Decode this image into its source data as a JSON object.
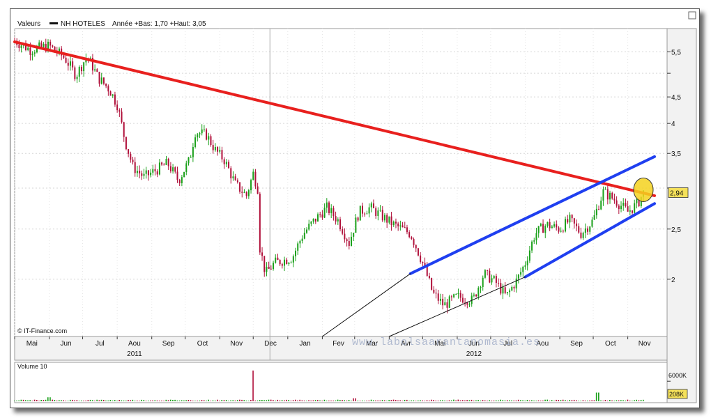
{
  "legend": {
    "label": "Valeurs",
    "series": "NH HOTELES",
    "range_text": "Année +Bas: 1,70 +Haut: 3,05"
  },
  "credit": "© IT-Finance.com",
  "watermark": "www.labolsaarantanomasia.es",
  "current_label": "2,94",
  "volume_label": "Volume 10",
  "volume_axis": {
    "top_label": "6000K",
    "current_label": "208K"
  },
  "colors": {
    "resistance": "#e8201e",
    "channel": "#1f3ff0",
    "up_candle": "#1aa01a",
    "down_candle": "#b0103a",
    "highlight": "#f5d21e"
  },
  "chart_data": [
    {
      "type": "candlestick",
      "title": "",
      "series_name": "NH HOTELES",
      "y_scale": "log",
      "y_ticks": [
        2,
        2.5,
        3,
        3.5,
        4,
        4.5,
        5,
        5.5
      ],
      "y_tick_labels": [
        "2",
        "2,5",
        "",
        "3,5",
        "4",
        "4,5",
        "",
        "5,5"
      ],
      "x_months": [
        "Mai",
        "Jun",
        "Jul",
        "Aou",
        "Sep",
        "Oct",
        "Nov",
        "Dec",
        "Jan",
        "Fev",
        "Mar",
        "Avr",
        "Mai",
        "Jun",
        "Jul",
        "Aou",
        "Sep",
        "Oct",
        "Nov"
      ],
      "years": [
        {
          "label": "2011",
          "month_index": 3.5
        },
        {
          "label": "2012",
          "month_index": 13.5
        }
      ],
      "year_divider_month": 7.5,
      "price_path": [
        [
          "2011-05-01",
          5.78
        ],
        [
          "2011-05-15",
          5.55
        ],
        [
          "2011-06-01",
          5.65
        ],
        [
          "2011-06-15",
          5.35
        ],
        [
          "2011-06-25",
          4.95
        ],
        [
          "2011-07-05",
          5.4
        ],
        [
          "2011-07-15",
          4.9
        ],
        [
          "2011-07-25",
          4.65
        ],
        [
          "2011-08-01",
          4.35
        ],
        [
          "2011-08-08",
          3.7
        ],
        [
          "2011-08-15",
          3.3
        ],
        [
          "2011-08-25",
          3.15
        ],
        [
          "2011-09-05",
          3.25
        ],
        [
          "2011-09-15",
          3.35
        ],
        [
          "2011-09-25",
          3.1
        ],
        [
          "2011-10-05",
          3.4
        ],
        [
          "2011-10-10",
          3.85
        ],
        [
          "2011-10-20",
          3.8
        ],
        [
          "2011-10-28",
          3.55
        ],
        [
          "2011-11-05",
          3.4
        ],
        [
          "2011-11-15",
          3.05
        ],
        [
          "2011-11-25",
          2.9
        ],
        [
          "2011-12-01",
          3.2
        ],
        [
          "2011-12-05",
          3.0
        ],
        [
          "2011-12-06",
          2.35
        ],
        [
          "2011-12-12",
          2.05
        ],
        [
          "2011-12-20",
          2.15
        ],
        [
          "2012-01-05",
          2.2
        ],
        [
          "2012-01-15",
          2.45
        ],
        [
          "2012-01-25",
          2.6
        ],
        [
          "2012-02-05",
          2.75
        ],
        [
          "2012-02-15",
          2.6
        ],
        [
          "2012-02-25",
          2.35
        ],
        [
          "2012-03-05",
          2.7
        ],
        [
          "2012-03-15",
          2.75
        ],
        [
          "2012-03-25",
          2.65
        ],
        [
          "2012-04-05",
          2.55
        ],
        [
          "2012-04-20",
          2.45
        ],
        [
          "2012-05-01",
          2.15
        ],
        [
          "2012-05-10",
          1.88
        ],
        [
          "2012-05-20",
          1.78
        ],
        [
          "2012-06-01",
          1.85
        ],
        [
          "2012-06-15",
          1.82
        ],
        [
          "2012-06-25",
          2.05
        ],
        [
          "2012-07-05",
          1.98
        ],
        [
          "2012-07-15",
          1.85
        ],
        [
          "2012-07-25",
          2.0
        ],
        [
          "2012-08-01",
          2.15
        ],
        [
          "2012-08-10",
          2.45
        ],
        [
          "2012-08-20",
          2.55
        ],
        [
          "2012-09-01",
          2.5
        ],
        [
          "2012-09-10",
          2.6
        ],
        [
          "2012-09-20",
          2.45
        ],
        [
          "2012-10-01",
          2.6
        ],
        [
          "2012-10-10",
          2.95
        ],
        [
          "2012-10-20",
          2.85
        ],
        [
          "2012-11-01",
          2.7
        ],
        [
          "2012-11-10",
          2.8
        ],
        [
          "2012-11-15",
          2.94
        ]
      ],
      "last_value": 2.94,
      "low": 1.7,
      "high": 3.05,
      "trendlines": [
        {
          "role": "resistance",
          "from": [
            "2011-05-01",
            5.75
          ],
          "to": [
            "2012-11-25",
            2.9
          ]
        },
        {
          "role": "channel-upper",
          "from": [
            "2012-04-20",
            2.05
          ],
          "to": [
            "2012-11-25",
            3.45
          ]
        },
        {
          "role": "channel-lower",
          "from": [
            "2012-08-01",
            2.02
          ],
          "to": [
            "2012-11-25",
            2.8
          ]
        },
        {
          "role": "support-thin",
          "from": [
            "2012-02-01",
            1.55
          ],
          "to": [
            "2012-04-20",
            2.05
          ]
        },
        {
          "role": "support-thin-2",
          "from": [
            "2012-04-01",
            1.55
          ],
          "to": [
            "2012-08-01",
            2.02
          ]
        }
      ]
    },
    {
      "type": "bar",
      "title": "Volume 10",
      "y_ticks_k": [
        6000
      ],
      "last_value_k": 208,
      "spikes": [
        [
          "2011-12-01",
          9200
        ],
        [
          "2012-10-05",
          2600
        ],
        [
          "2011-06-01",
          1200
        ],
        [
          "2012-03-01",
          900
        ]
      ]
    }
  ]
}
